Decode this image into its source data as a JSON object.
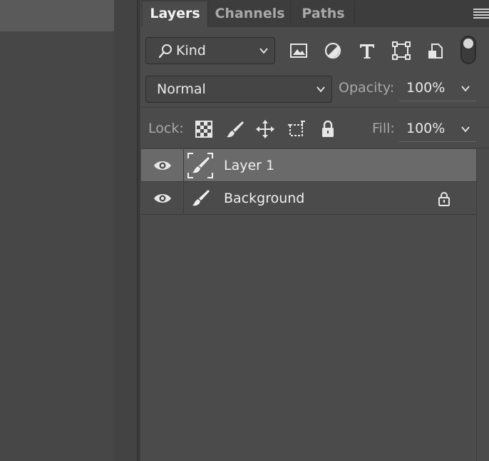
{
  "tabs": [
    {
      "label": "Layers",
      "active": true
    },
    {
      "label": "Channels",
      "active": false
    },
    {
      "label": "Paths",
      "active": false
    }
  ],
  "filter": {
    "kind_label": "Kind",
    "icons": [
      "image-filter-icon",
      "adjustment-filter-icon",
      "type-filter-icon",
      "shape-filter-icon",
      "smart-object-filter-icon"
    ]
  },
  "blend": {
    "mode": "Normal",
    "opacity_label": "Opacity:",
    "opacity_value": "100%"
  },
  "lock": {
    "label": "Lock:",
    "fill_label": "Fill:",
    "fill_value": "100%"
  },
  "layers": [
    {
      "name": "Layer 1",
      "selected": true,
      "visible": true,
      "locked": false
    },
    {
      "name": "Background",
      "selected": false,
      "visible": true,
      "locked": true
    }
  ],
  "colors": {
    "panel_bg": "#4b4b4b",
    "tabbar_bg": "#3d3d3d",
    "selected_row": "#6a6a6a",
    "text": "#f0f0f0",
    "muted_text": "#a8a8a8"
  }
}
